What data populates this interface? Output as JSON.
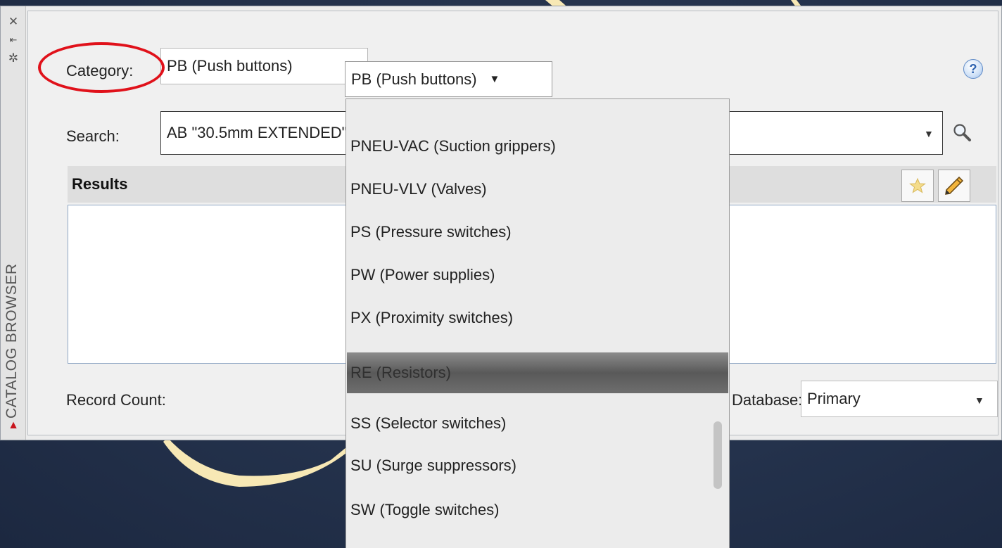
{
  "palette": {
    "side_title": "CATALOG BROWSER",
    "category_label": "Category:",
    "category_value": "PB (Push buttons)",
    "search_label": "Search:",
    "search_value": "AB \"30.5mm EXTENDED\"",
    "results_label": "Results",
    "record_count_label": "Record Count:",
    "database_label": "Database:",
    "database_value": "Primary",
    "help_glyph": "?"
  },
  "dropdown": {
    "selected": "PB (Push buttons)",
    "items": [
      "PNEU-VAC (Suction grippers)",
      "PNEU-VLV (Valves)",
      "PS (Pressure switches)",
      "PW (Power supplies)",
      "PX (Proximity switches)",
      "RE (Resistors)",
      "SS (Selector switches)",
      "SU (Surge suppressors)",
      "SW (Toggle switches)"
    ],
    "highlighted_item": "RE (Resistors)"
  },
  "icons": {
    "close": "close-icon",
    "auto_hide": "auto-hide-icon",
    "properties": "properties-icon",
    "search": "search-icon",
    "favorite": "star-icon",
    "edit": "pencil-icon",
    "app_logo": "autocad-logo-icon"
  },
  "colors": {
    "annotation": "#e0111a",
    "selection": "#6e6e6e",
    "background": "#24324c",
    "decoration": "#f7e8b5"
  }
}
